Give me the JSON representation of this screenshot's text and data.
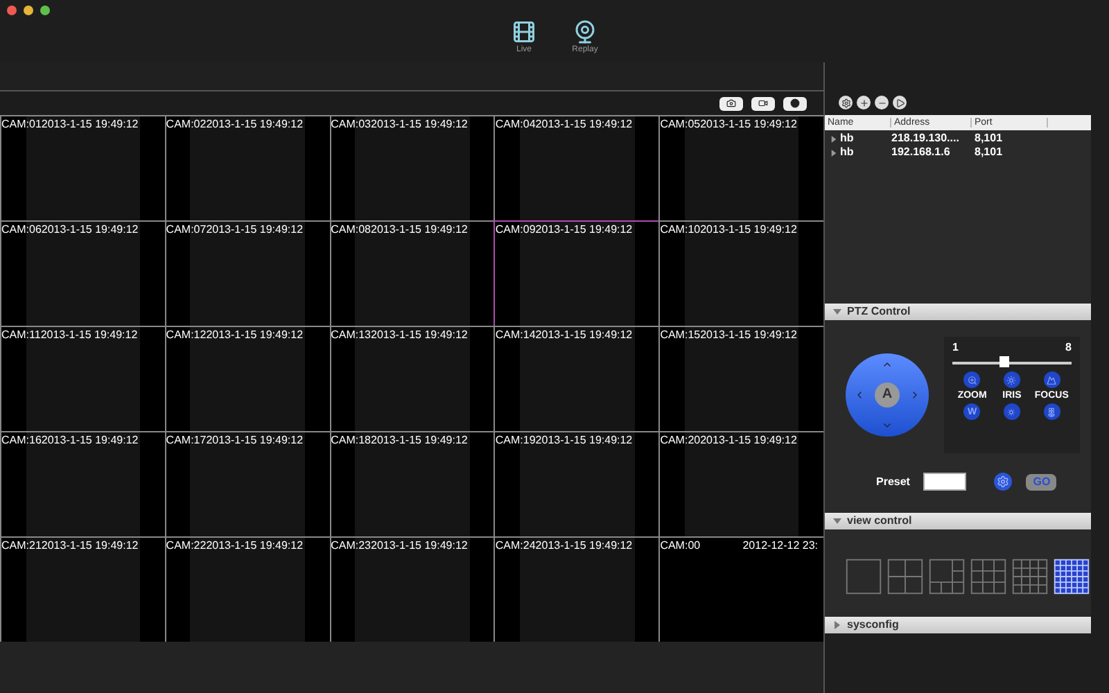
{
  "window": {
    "buttons": [
      {
        "color": "#ee5a52"
      },
      {
        "color": "#e6b43a"
      },
      {
        "color": "#5fbf4a"
      }
    ]
  },
  "toolbar": [
    {
      "label": "Live",
      "kind": "film"
    },
    {
      "label": "Replay",
      "kind": "webcam"
    }
  ],
  "view_actions": [
    {
      "kind": "snapshot"
    },
    {
      "kind": "record"
    },
    {
      "kind": "stop"
    }
  ],
  "cameras": [
    {
      "cam": "CAM:01",
      "time": "2013-1-15 19:49:12",
      "selected": false
    },
    {
      "cam": "CAM:02",
      "time": "2013-1-15 19:49:12",
      "selected": false
    },
    {
      "cam": "CAM:03",
      "time": "2013-1-15 19:49:12",
      "selected": false
    },
    {
      "cam": "CAM:04",
      "time": "2013-1-15 19:49:12",
      "selected": false
    },
    {
      "cam": "CAM:05",
      "time": "2013-1-15 19:49:12",
      "selected": false
    },
    {
      "cam": "CAM:06",
      "time": "2013-1-15 19:49:12",
      "selected": false
    },
    {
      "cam": "CAM:07",
      "time": "2013-1-15 19:49:12",
      "selected": false
    },
    {
      "cam": "CAM:08",
      "time": "2013-1-15 19:49:12",
      "selected": false
    },
    {
      "cam": "CAM:09",
      "time": "2013-1-15 19:49:12",
      "selected": true
    },
    {
      "cam": "CAM:10",
      "time": "2013-1-15 19:49:12",
      "selected": false
    },
    {
      "cam": "CAM:11",
      "time": "2013-1-15 19:49:12",
      "selected": false
    },
    {
      "cam": "CAM:12",
      "time": "2013-1-15 19:49:12",
      "selected": false
    },
    {
      "cam": "CAM:13",
      "time": "2013-1-15 19:49:12",
      "selected": false
    },
    {
      "cam": "CAM:14",
      "time": "2013-1-15 19:49:12",
      "selected": false
    },
    {
      "cam": "CAM:15",
      "time": "2013-1-15 19:49:12",
      "selected": false
    },
    {
      "cam": "CAM:16",
      "time": "2013-1-15 19:49:12",
      "selected": false
    },
    {
      "cam": "CAM:17",
      "time": "2013-1-15 19:49:12",
      "selected": false
    },
    {
      "cam": "CAM:18",
      "time": "2013-1-15 19:49:12",
      "selected": false
    },
    {
      "cam": "CAM:19",
      "time": "2013-1-15 19:49:12",
      "selected": false
    },
    {
      "cam": "CAM:20",
      "time": "2013-1-15 19:49:12",
      "selected": false
    },
    {
      "cam": "CAM:21",
      "time": "2013-1-15 19:49:12",
      "selected": false
    },
    {
      "cam": "CAM:22",
      "time": "2013-1-15 19:49:12",
      "selected": false
    },
    {
      "cam": "CAM:23",
      "time": "2013-1-15 19:49:12",
      "selected": false
    },
    {
      "cam": "CAM:24",
      "time": "2013-1-15 19:49:12",
      "selected": false
    },
    {
      "cam": "CAM:00",
      "time": "2012-12-12 23:",
      "selected": false,
      "kind": "empty"
    }
  ],
  "device_actions": [
    {
      "kind": "settings"
    },
    {
      "kind": "add"
    },
    {
      "kind": "remove"
    },
    {
      "kind": "play"
    }
  ],
  "devices": {
    "columns": [
      "Name",
      "Address",
      "Port"
    ],
    "rows": [
      {
        "name": "hb",
        "address": "218.19.130....",
        "port": "8,101",
        "expanded": false
      },
      {
        "name": "hb",
        "address": "192.168.1.6",
        "port": "8,101",
        "expanded": false
      }
    ]
  },
  "ptz": {
    "title": "PTZ Control",
    "expanded": true,
    "center": "A",
    "speed_min": "1",
    "speed_max": "8",
    "level": 0.43,
    "buttons": [
      {
        "kind": "tele"
      },
      {
        "kind": "iris-open"
      },
      {
        "kind": "focus-far"
      },
      {
        "kind": "wide",
        "label": "W"
      },
      {
        "kind": "iris-close"
      },
      {
        "kind": "focus-near"
      }
    ],
    "labels": [
      "ZOOM",
      "IRIS",
      "FOCUS"
    ],
    "preset_label": "Preset",
    "go": "GO"
  },
  "view_control": {
    "title": "view control",
    "expanded": true,
    "layouts": [
      {
        "kind": "single",
        "selected": false
      },
      {
        "kind": "quad",
        "selected": false
      },
      {
        "kind": "six",
        "selected": false
      },
      {
        "kind": "nine",
        "selected": false
      },
      {
        "kind": "sixteen",
        "selected": false
      },
      {
        "kind": "thirtysix",
        "selected": true
      }
    ]
  },
  "sysconfig": {
    "title": "sysconfig",
    "expanded": false
  }
}
